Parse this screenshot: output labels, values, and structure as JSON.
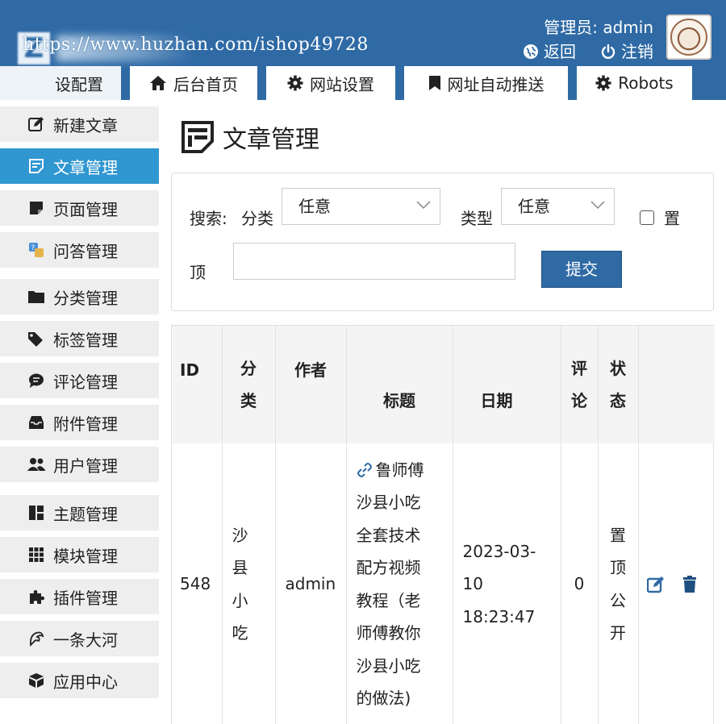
{
  "header": {
    "watermark": "https://www.huzhan.com/ishop49728",
    "admin_label": "管理员: admin",
    "back_label": "返回",
    "logout_label": "注销"
  },
  "topnav": {
    "tabs": [
      {
        "label": "设配置",
        "icon": "none"
      },
      {
        "label": "后台首页",
        "icon": "home-icon"
      },
      {
        "label": "网站设置",
        "icon": "gear-icon"
      },
      {
        "label": "网址自动推送",
        "icon": "bookmark-icon"
      },
      {
        "label": "Robots",
        "icon": "gear-icon"
      }
    ]
  },
  "sidebar": {
    "items": [
      {
        "label": "新建文章",
        "icon": "edit-icon",
        "active": false
      },
      {
        "label": "文章管理",
        "icon": "article-icon",
        "active": true
      },
      {
        "label": "页面管理",
        "icon": "page-icon",
        "active": false
      },
      {
        "label": "问答管理",
        "icon": "qa-icon",
        "active": false
      },
      {
        "label": "分类管理",
        "icon": "folder-icon",
        "active": false
      },
      {
        "label": "标签管理",
        "icon": "tag-icon",
        "active": false
      },
      {
        "label": "评论管理",
        "icon": "comment-icon",
        "active": false
      },
      {
        "label": "附件管理",
        "icon": "inbox-icon",
        "active": false
      },
      {
        "label": "用户管理",
        "icon": "users-icon",
        "active": false
      },
      {
        "label": "主题管理",
        "icon": "layout-icon",
        "active": false
      },
      {
        "label": "模块管理",
        "icon": "grid-icon",
        "active": false
      },
      {
        "label": "插件管理",
        "icon": "puzzle-icon",
        "active": false
      },
      {
        "label": "一条大河",
        "icon": "plugin-logo-icon",
        "active": false
      },
      {
        "label": "应用中心",
        "icon": "box-icon",
        "active": false
      }
    ]
  },
  "main": {
    "title": "文章管理",
    "search": {
      "search_label": "搜索:",
      "category_label": "分类",
      "category_value": "任意",
      "type_label": "类型",
      "type_value": "任意",
      "top_label_1": "置",
      "top_label_2": "顶",
      "keyword_value": "",
      "submit_label": "提交"
    },
    "table": {
      "headers": {
        "id": "ID",
        "category": [
          "分",
          "类"
        ],
        "author": "作者",
        "title": "标题",
        "date": "日期",
        "comments": [
          "评",
          "论"
        ],
        "status": [
          "状",
          "态"
        ]
      },
      "rows": [
        {
          "id": "548",
          "category": [
            "沙",
            "县",
            "小",
            "吃"
          ],
          "author": "admin",
          "title_lines": [
            "鲁师傅",
            "沙县小吃",
            "全套技术",
            "配方视频",
            "教程（老",
            "师傅教你",
            "沙县小吃",
            "的做法)"
          ],
          "date_lines": [
            "2023-03-",
            "10",
            "18:23:47"
          ],
          "comments": "0",
          "status": [
            "置",
            "顶",
            "公",
            "开"
          ]
        }
      ]
    }
  },
  "colors": {
    "header_bg": "#2f6aa5",
    "sidebar_active": "#3097d1",
    "button_bg": "#2f6aa5"
  }
}
